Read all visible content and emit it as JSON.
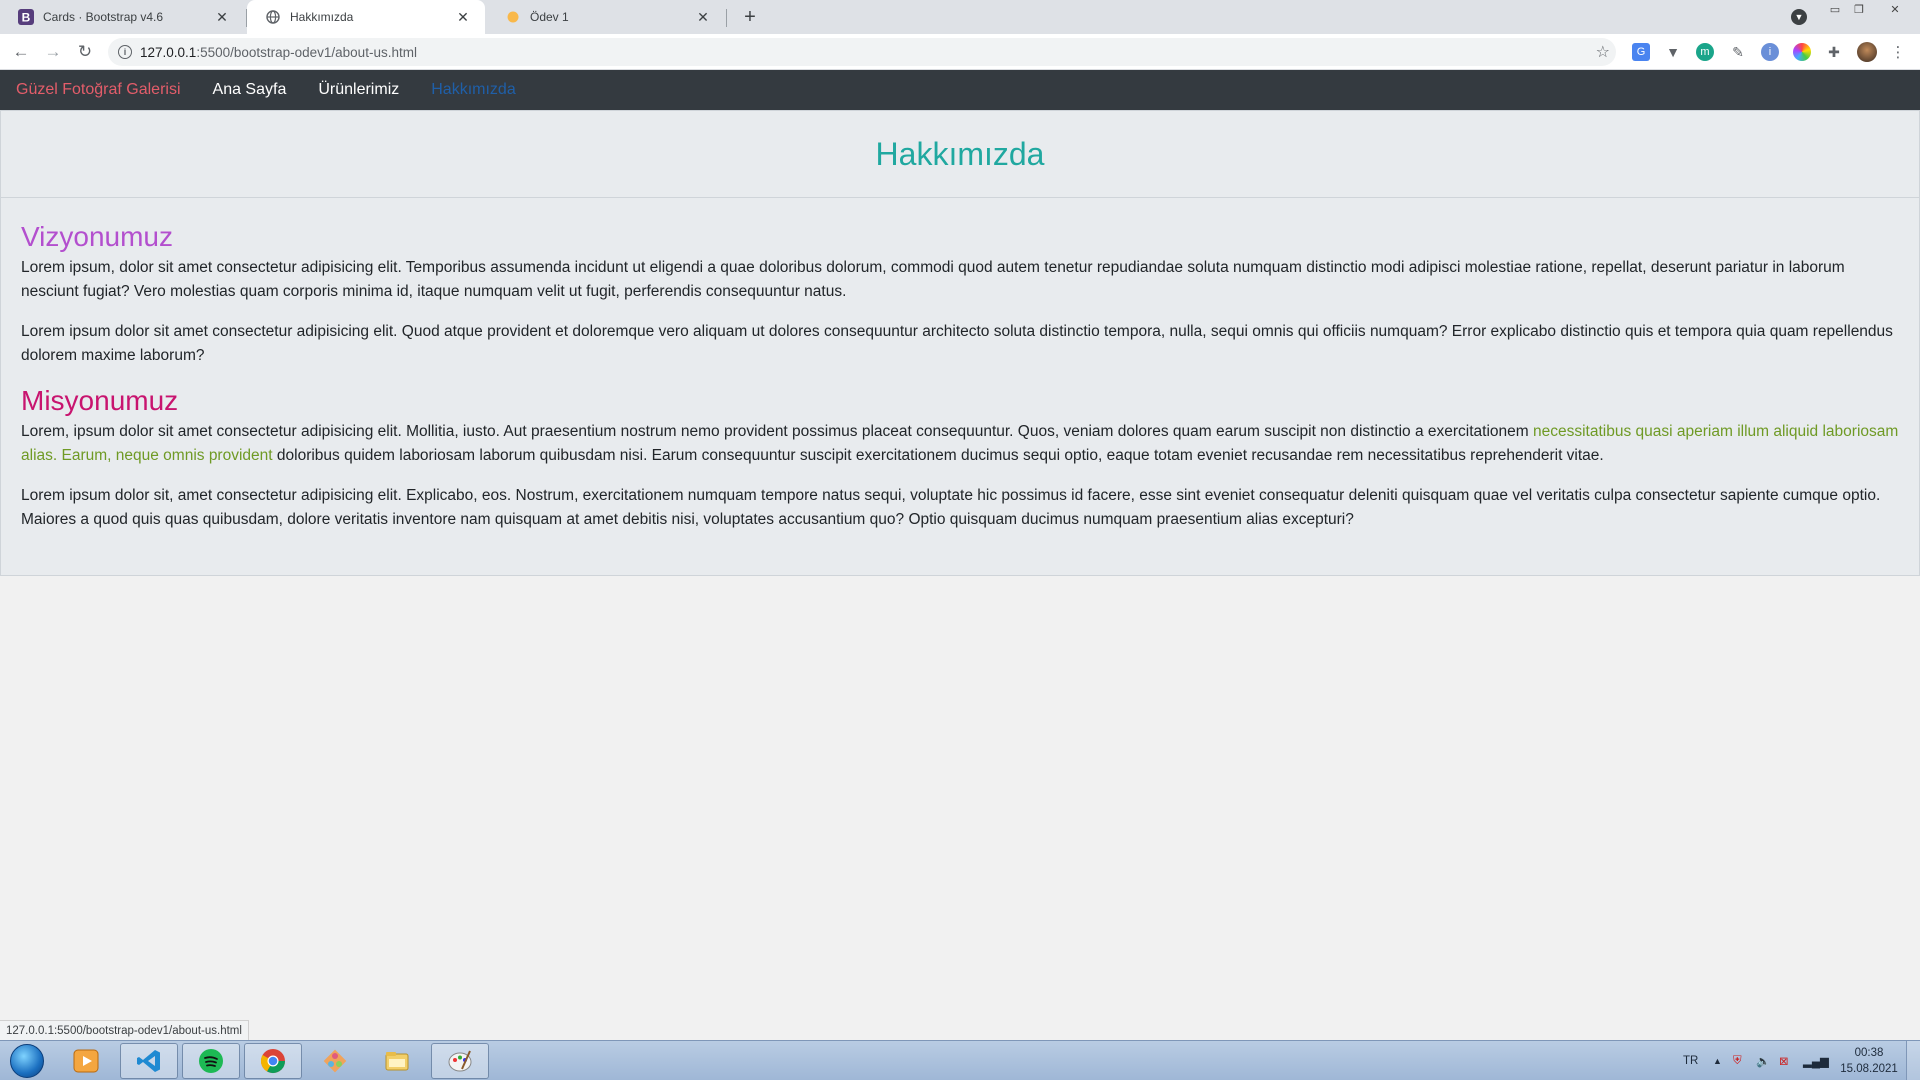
{
  "browser": {
    "tabs": [
      {
        "title": "Cards · Bootstrap v4.6",
        "favicon": "bootstrap-icon",
        "active": false
      },
      {
        "title": "Hakkımızda",
        "favicon": "globe-icon",
        "active": true
      },
      {
        "title": "Ödev 1",
        "favicon": "dot-icon",
        "active": false
      }
    ],
    "url_host": "127.0.0.1",
    "url_path": ":5500/bootstrap-odev1/about-us.html",
    "status_url": "127.0.0.1:5500/bootstrap-odev1/about-us.html"
  },
  "navbar": {
    "brand": "Güzel Fotoğraf Galerisi",
    "links": [
      "Ana Sayfa",
      "Ürünlerimiz",
      "Hakkımızda"
    ],
    "active_index": 2
  },
  "card": {
    "title": "Hakkımızda",
    "vision_heading": "Vizyonumuz",
    "vision_p1": "Lorem ipsum, dolor sit amet consectetur adipisicing elit. Temporibus assumenda incidunt ut eligendi a quae doloribus dolorum, commodi quod autem tenetur repudiandae soluta numquam distinctio modi adipisci molestiae ratione, repellat, deserunt pariatur in laborum nesciunt fugiat? Vero molestias quam corporis minima id, itaque numquam velit ut fugit, perferendis consequuntur natus.",
    "vision_p2": "Lorem ipsum dolor sit amet consectetur adipisicing elit. Quod atque provident et doloremque vero aliquam ut dolores consequuntur architecto soluta distinctio tempora, nulla, sequi omnis qui officiis numquam? Error explicabo distinctio quis et tempora quia quam repellendus dolorem maxime laborum?",
    "mission_heading": "Misyonumuz",
    "mission_p1_a": "Lorem, ipsum dolor sit amet consectetur adipisicing elit. Mollitia, iusto. Aut praesentium nostrum nemo provident possimus placeat consequuntur. Quos, veniam dolores quam earum suscipit non distinctio a exercitationem ",
    "mission_p1_green": "necessitatibus quasi aperiam illum aliquid laboriosam alias. Earum, neque omnis provident",
    "mission_p1_b": " doloribus quidem laboriosam laborum quibusdam nisi. Earum consequuntur suscipit exercitationem ducimus sequi optio, eaque totam eveniet recusandae rem necessitatibus reprehenderit vitae.",
    "mission_p2": "Lorem ipsum dolor sit, amet consectetur adipisicing elit. Explicabo, eos. Nostrum, exercitationem numquam tempore natus sequi, voluptate hic possimus id facere, esse sint eveniet consequatur deleniti quisquam quae vel veritatis culpa consectetur sapiente cumque optio. Maiores a quod quis quas quibusdam, dolore veritatis inventore nam quisquam at amet debitis nisi, voluptates accusantium quo? Optio quisquam ducimus numquam praesentium alias excepturi?"
  },
  "taskbar": {
    "language": "TR",
    "time": "00:38",
    "date": "15.08.2021"
  },
  "colors": {
    "brand": "#e35d6a",
    "title": "#20a8a0",
    "vision": "#b34fce",
    "mission": "#c8146f",
    "highlight": "#6f9a25"
  }
}
